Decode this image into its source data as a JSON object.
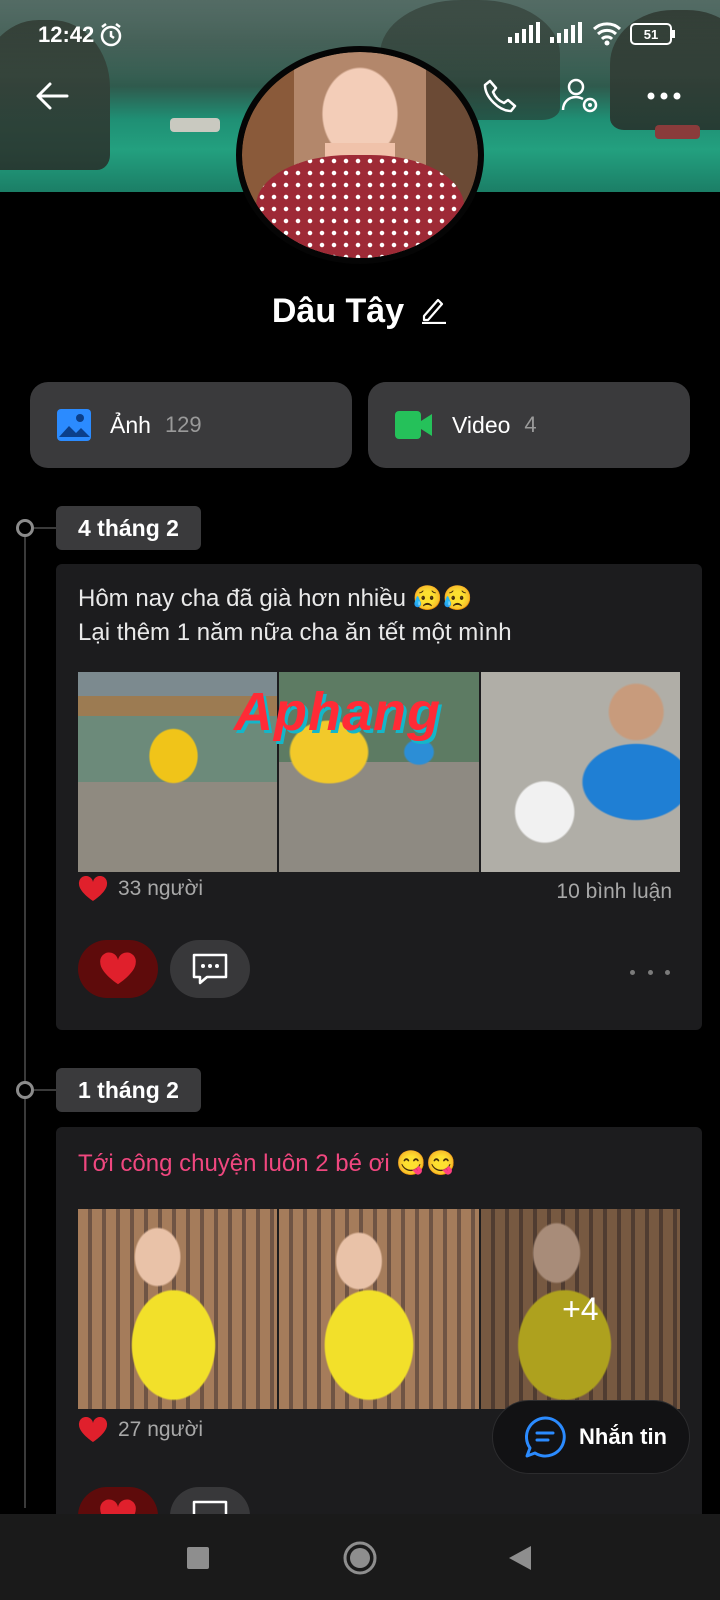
{
  "status_bar": {
    "time": "12:42",
    "battery": "51"
  },
  "profile": {
    "name": "Dâu Tây"
  },
  "media": {
    "photos": {
      "label": "Ảnh",
      "count": "129"
    },
    "videos": {
      "label": "Video",
      "count": "4"
    }
  },
  "posts": [
    {
      "date": "4 tháng 2",
      "text_line1": "Hôm nay cha đã già hơn nhiều 😥😥",
      "text_line2": "Lại thêm 1 năm nữa cha ăn tết một mình",
      "watermark": "Aphang",
      "likes": "33 người",
      "comments": "10 bình luận"
    },
    {
      "date": "1 tháng 2",
      "text_line1": "Tới công chuyện luôn 2 bé ơi 😋😋",
      "more_photos": "+4",
      "likes": "27 người"
    }
  ],
  "fab": {
    "label": "Nhắn tin"
  },
  "colors": {
    "like": "#e0202c",
    "accent_blue": "#2b8bff",
    "video_green": "#25c15a"
  },
  "icons": [
    "back-arrow-icon",
    "phone-icon",
    "user-settings-icon",
    "more-icon",
    "edit-icon",
    "image-icon",
    "video-icon",
    "heart-icon",
    "comment-icon",
    "message-icon"
  ]
}
